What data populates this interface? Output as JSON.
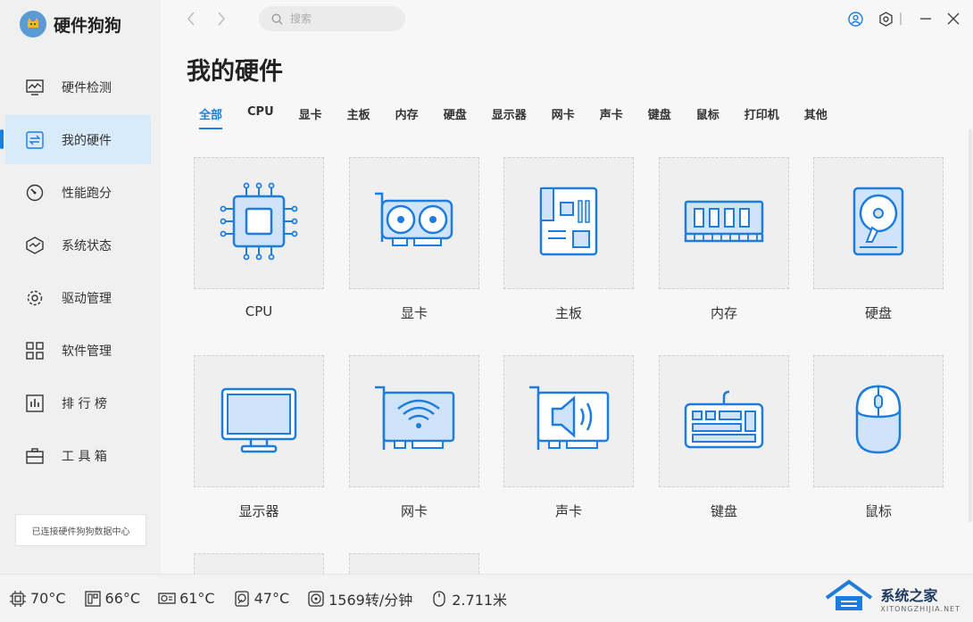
{
  "app": {
    "name": "硬件狗狗"
  },
  "search": {
    "placeholder": "搜索"
  },
  "sidebar": {
    "items": [
      {
        "label": "硬件检测",
        "icon": "monitor-chart-icon"
      },
      {
        "label": "我的硬件",
        "icon": "hardware-swap-icon",
        "active": true
      },
      {
        "label": "性能跑分",
        "icon": "gauge-icon"
      },
      {
        "label": "系统状态",
        "icon": "pulse-box-icon"
      },
      {
        "label": "驱动管理",
        "icon": "gear-icon"
      },
      {
        "label": "软件管理",
        "icon": "apps-grid-icon"
      },
      {
        "label": "排 行 榜",
        "icon": "bar-ranking-icon"
      },
      {
        "label": "工 具 箱",
        "icon": "toolbox-icon"
      }
    ],
    "connection_status": "已连接硬件狗狗数据中心"
  },
  "main": {
    "title": "我的硬件",
    "tabs": [
      "全部",
      "CPU",
      "显卡",
      "主板",
      "内存",
      "硬盘",
      "显示器",
      "网卡",
      "声卡",
      "键盘",
      "鼠标",
      "打印机",
      "其他"
    ],
    "active_tab": "全部",
    "cards": [
      {
        "label": "CPU",
        "icon": "cpu-icon"
      },
      {
        "label": "显卡",
        "icon": "graphics-card-icon"
      },
      {
        "label": "主板",
        "icon": "motherboard-icon"
      },
      {
        "label": "内存",
        "icon": "memory-icon"
      },
      {
        "label": "硬盘",
        "icon": "hard-disk-icon"
      },
      {
        "label": "显示器",
        "icon": "monitor-icon"
      },
      {
        "label": "网卡",
        "icon": "network-card-icon"
      },
      {
        "label": "声卡",
        "icon": "sound-card-icon"
      },
      {
        "label": "键盘",
        "icon": "keyboard-icon"
      },
      {
        "label": "鼠标",
        "icon": "mouse-icon"
      }
    ]
  },
  "status_bar": {
    "items": [
      {
        "value": "70°C",
        "icon": "cpu-temp-icon"
      },
      {
        "value": "66°C",
        "icon": "board-temp-icon"
      },
      {
        "value": "61°C",
        "icon": "gpu-temp-icon"
      },
      {
        "value": "47°C",
        "icon": "disk-temp-icon"
      },
      {
        "value": "1569转/分钟",
        "icon": "fan-icon"
      },
      {
        "value": "2.711米",
        "icon": "mouse-distance-icon"
      }
    ]
  },
  "watermark": {
    "title": "系统之家",
    "subtitle": "XITONGZHIJIA.NET"
  },
  "colors": {
    "accent": "#1e7ddc",
    "icon_stroke": "#1e7ddc",
    "icon_fill": "#cfe4f8"
  }
}
